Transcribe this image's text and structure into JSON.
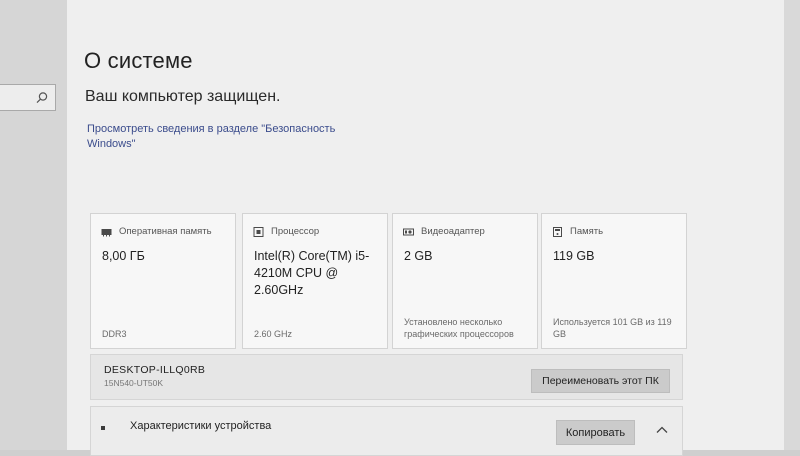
{
  "colors": {
    "link": "#3b4c8c",
    "button_bg": "#cbcbcb",
    "card_bg": "#f7f7f7",
    "page_bg": "#efefef"
  },
  "sidebar": {
    "search": {
      "value": "",
      "icon": "search-icon"
    }
  },
  "header": {
    "title": "О системе"
  },
  "security": {
    "status": "Ваш компьютер защищен.",
    "link": "Просмотреть сведения в разделе \"Безопасность Windows\""
  },
  "specs": {
    "cards": [
      {
        "icon": "memory-icon",
        "label": "Оперативная память",
        "value": "8,00 ГБ",
        "sub": "DDR3"
      },
      {
        "icon": "processor-icon",
        "label": "Процессор",
        "value": "Intel(R) Core(TM) i5-4210M CPU @ 2.60GHz",
        "sub": "2.60 GHz"
      },
      {
        "icon": "video-adapter-icon",
        "label": "Видеоадаптер",
        "value": "2 GB",
        "sub": "Установлено несколько графических процессоров"
      },
      {
        "icon": "storage-icon",
        "label": "Память",
        "value": "119 GB",
        "sub": "Используется 101 GB из 119 GB"
      }
    ]
  },
  "device": {
    "name": "DESKTOP-ILLQ0RB",
    "model": "15N540-UT50K",
    "rename_label": "Переименовать этот ПК"
  },
  "characteristics": {
    "title": "Характеристики устройства",
    "copy_label": "Копировать",
    "toggle_icon": "chevron-up-icon"
  }
}
